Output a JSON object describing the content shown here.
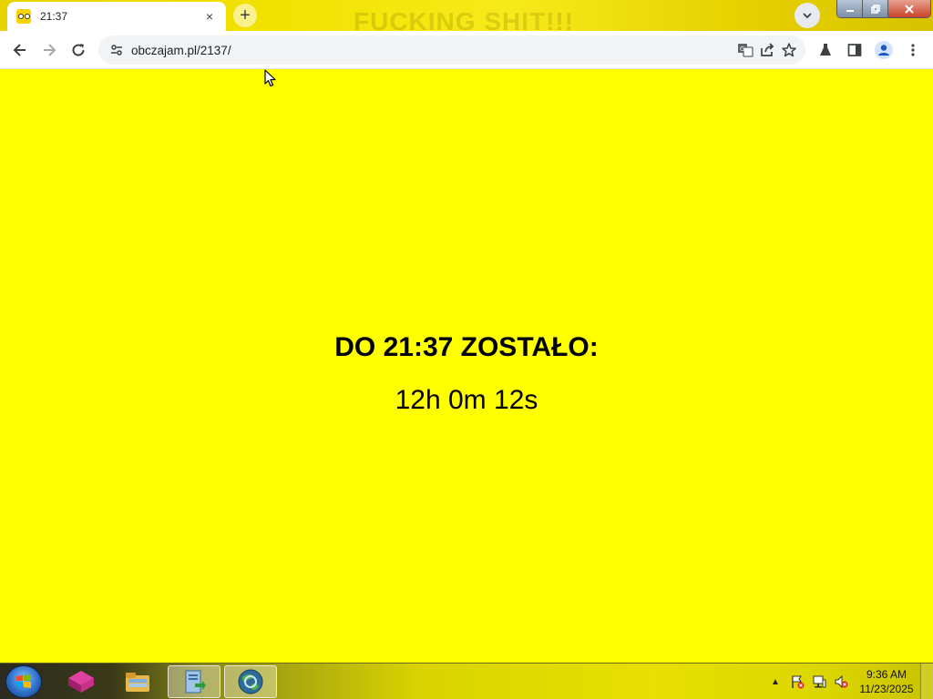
{
  "browser": {
    "tab_title": "21:37",
    "tab_close": "×",
    "new_tab": "+",
    "banner_text": "FUCKING SHIT!!!",
    "url": "obczajam.pl/2137/"
  },
  "page": {
    "heading": "DO 21:37 ZOSTAŁO:",
    "countdown": "12h 0m 12s",
    "background_color": "#ffff00"
  },
  "taskbar": {
    "time": "9:36 AM",
    "date": "11/23/2025",
    "tray_expand": "▲"
  },
  "icons": [
    "site-favicon",
    "chevron-down-icon",
    "back-arrow-icon",
    "forward-arrow-icon",
    "reload-icon",
    "site-settings-icon",
    "translate-icon",
    "share-icon",
    "star-icon",
    "labs-flask-icon",
    "side-panel-icon",
    "profile-icon",
    "more-vert-icon",
    "windows-start-icon",
    "network-icon",
    "volume-muted-icon",
    "flag-icon"
  ]
}
